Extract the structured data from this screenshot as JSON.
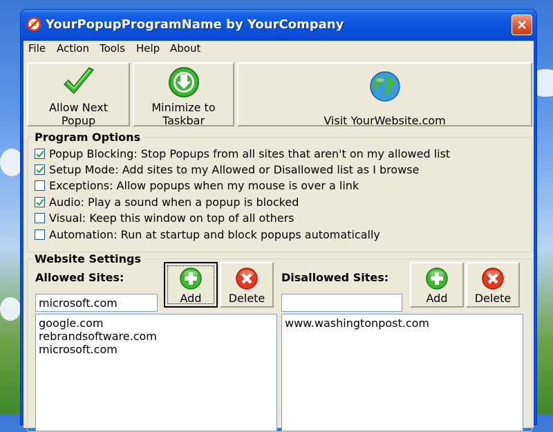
{
  "window": {
    "title": "YourPopupProgramName by YourCompany"
  },
  "menu": [
    "File",
    "Action",
    "Tools",
    "Help",
    "About"
  ],
  "toolbar": {
    "allow_next_popup": {
      "line1": "Allow Next",
      "line2": "Popup",
      "icon": "green-checkmark-icon"
    },
    "minimize_to_taskbar": {
      "line1": "Minimize to",
      "line2": "Taskbar",
      "icon": "green-download-arrow-icon"
    },
    "visit_website": {
      "label": "Visit YourWebsite.com",
      "icon": "globe-icon"
    }
  },
  "program_options": {
    "title": "Program Options",
    "options": [
      {
        "label": "Popup Blocking: Stop Popups from all sites that aren't on my allowed list",
        "checked": true
      },
      {
        "label": "Setup Mode: Add sites to my Allowed or Disallowed list as I browse",
        "checked": true
      },
      {
        "label": "Exceptions: Allow popups when my mouse is over a link",
        "checked": false
      },
      {
        "label": "Audio: Play a sound when a popup is blocked",
        "checked": true
      },
      {
        "label": "Visual: Keep this window on top of all others",
        "checked": false
      },
      {
        "label": "Automation: Run at startup and block popups automatically",
        "checked": false
      }
    ]
  },
  "website_settings": {
    "title": "Website Settings",
    "allowed": {
      "label": "Allowed Sites:",
      "input_value": "microsoft.com",
      "add_label": "Add",
      "delete_label": "Delete",
      "sites": [
        "google.com",
        "rebrandsoftware.com",
        "microsoft.com"
      ]
    },
    "disallowed": {
      "label": "Disallowed Sites:",
      "input_value": "",
      "add_label": "Add",
      "delete_label": "Delete",
      "sites": [
        "www.washingtonpost.com"
      ]
    }
  },
  "colors": {
    "titlebar": "#0b54de",
    "client_bg": "#ece9d8",
    "check_green": "#21a121",
    "delete_red": "#e23a1e"
  }
}
